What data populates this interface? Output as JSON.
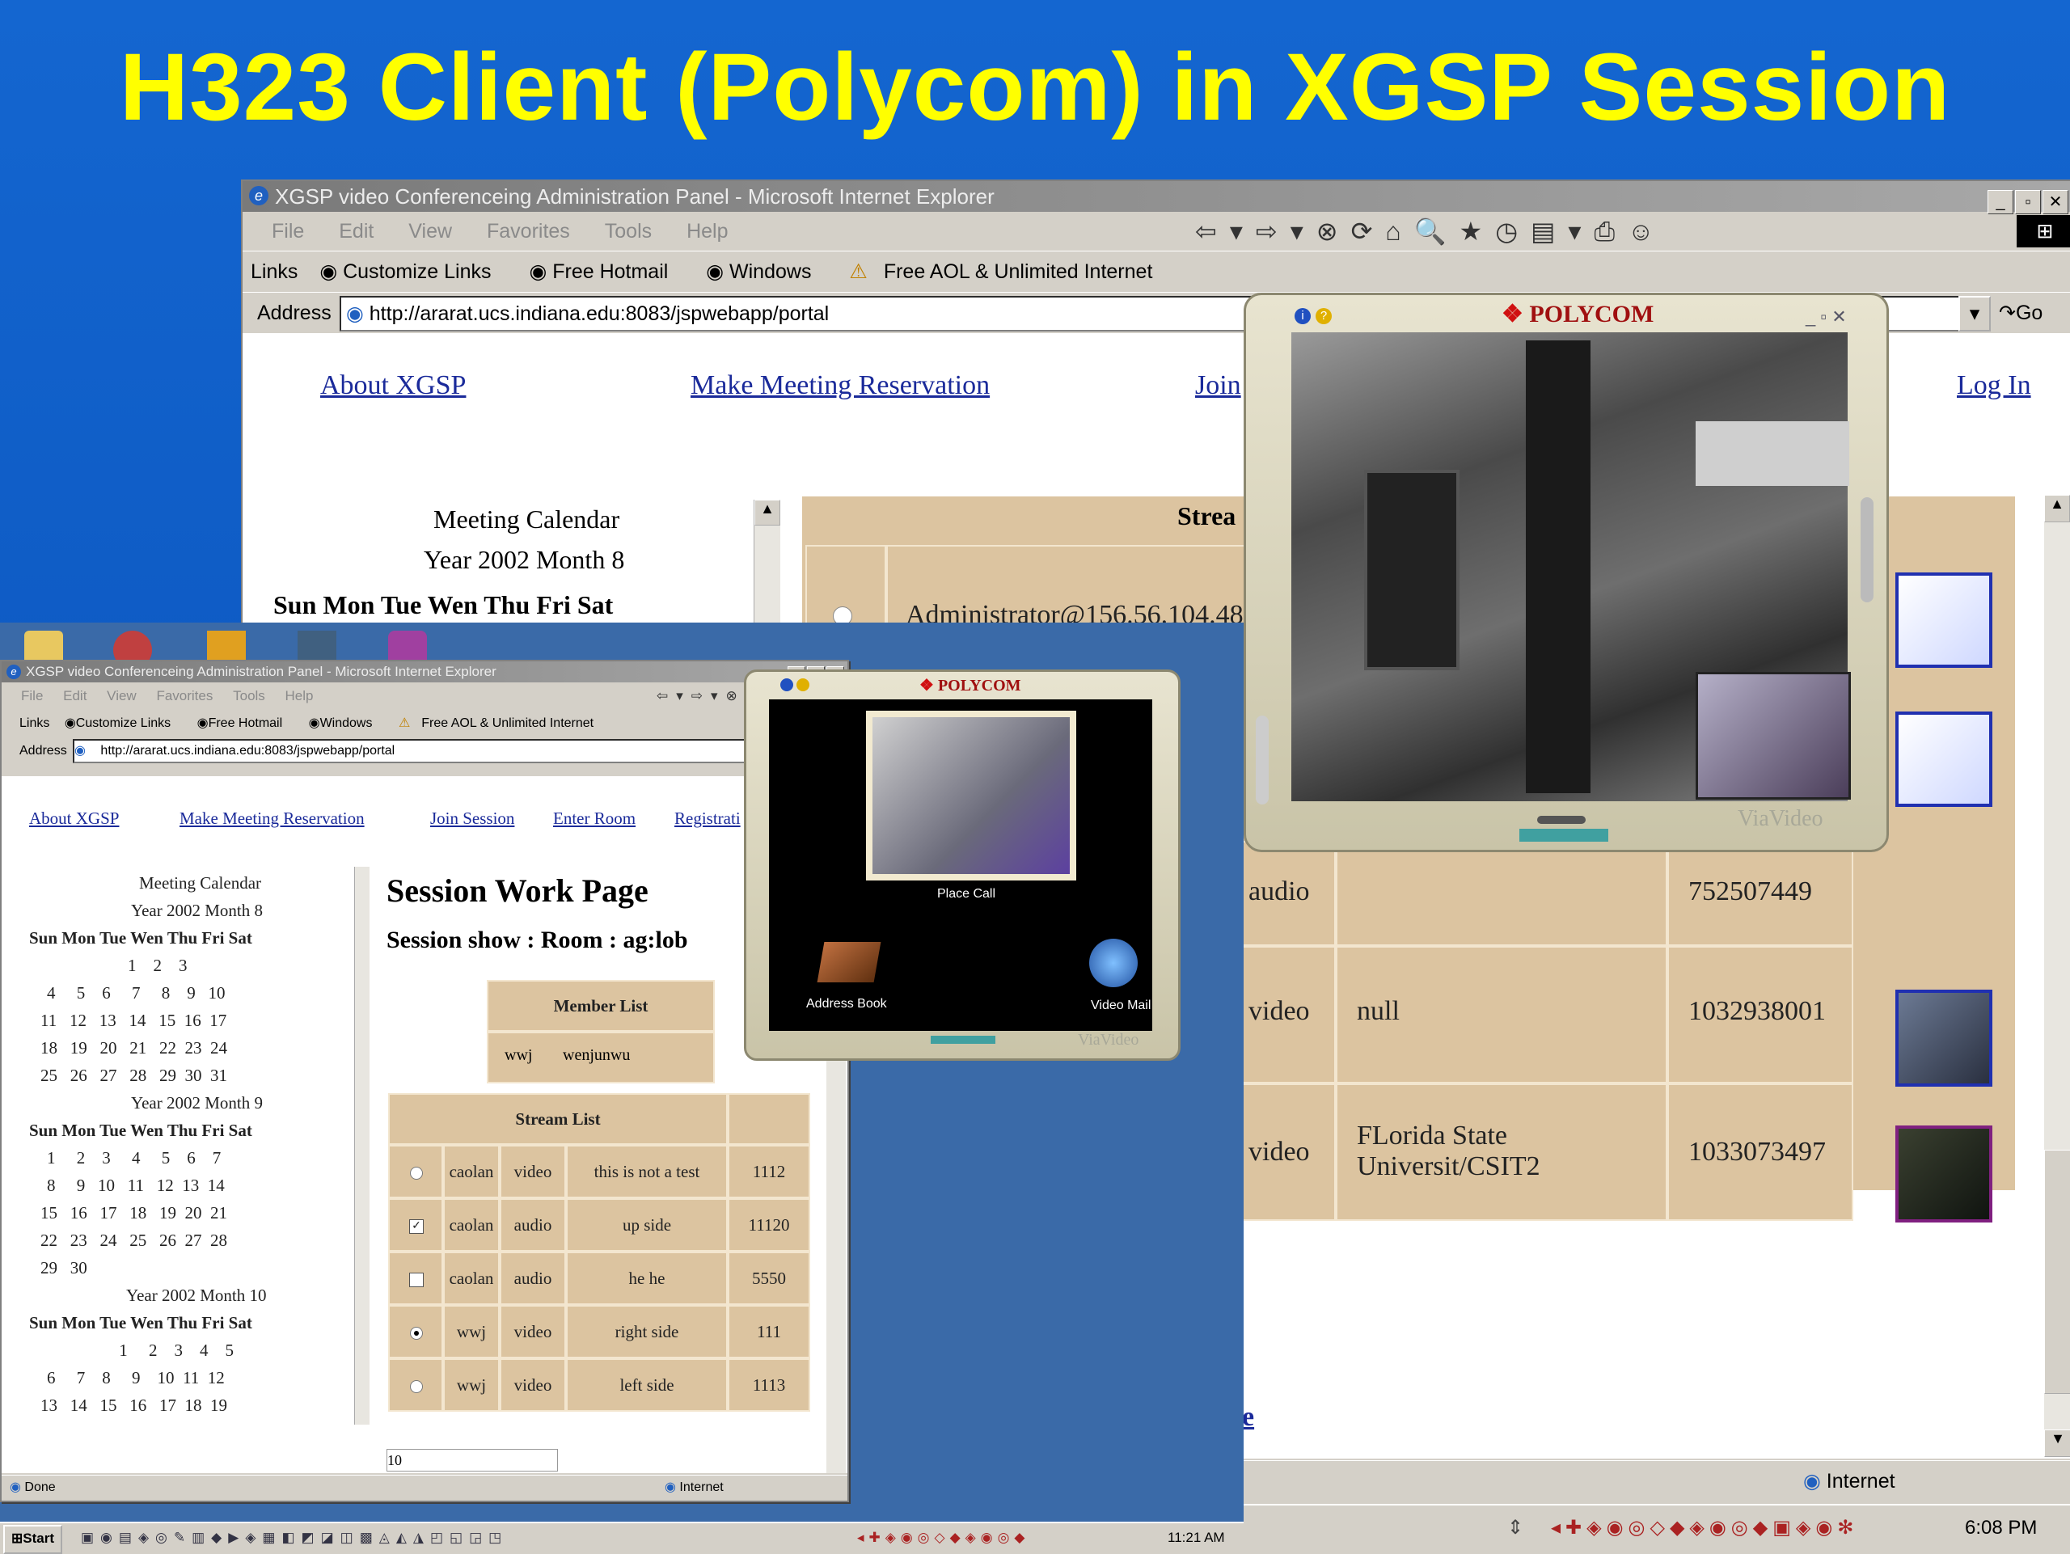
{
  "slide_title": "H323 Client (Polycom) in XGSP Session",
  "main_window": {
    "title": "XGSP video Conferenceing Administration Panel - Microsoft Internet Explorer",
    "menu": [
      "File",
      "Edit",
      "View",
      "Favorites",
      "Tools",
      "Help"
    ],
    "links_label": "Links",
    "links": [
      "Customize Links",
      "Free Hotmail",
      "Windows",
      "Free AOL & Unlimited Internet"
    ],
    "address_label": "Address",
    "address": "http://ararat.ucs.indiana.edu:8083/jspwebapp/portal",
    "go": "Go",
    "nav": {
      "about": "About XGSP",
      "reserve": "Make Meeting Reservation",
      "join": "Join",
      "login": "Log In"
    },
    "calendar": {
      "heading": "Meeting Calendar",
      "year_month": "Year 2002 Month 8",
      "days": "Sun Mon Tue Wen Thu Fri Sat"
    },
    "stream_header": "Strea",
    "admin_text": "Administrator@156.56.104.48",
    "rows": [
      {
        "type": "audio",
        "desc": "",
        "id": "752507449"
      },
      {
        "type": "video",
        "desc": "null",
        "id": "1032938001"
      },
      {
        "type": "video",
        "desc": "FLorida State Universit/CSIT2",
        "id": "1033073497"
      }
    ],
    "partial_link": "e",
    "status_zone": "Internet"
  },
  "polycom_large": {
    "brand": "POLYCOM",
    "footer": "ViaVideo"
  },
  "polycom_small": {
    "brand": "POLYCOM",
    "place_call": "Place Call",
    "address_book": "Address Book",
    "video_mail": "Video Mail",
    "footer": "ViaVideo"
  },
  "small_window": {
    "title": "XGSP video Conferenceing Administration Panel - Microsoft Internet Explorer",
    "menu": [
      "File",
      "Edit",
      "View",
      "Favorites",
      "Tools",
      "Help"
    ],
    "links_label": "Links",
    "links": [
      "Customize Links",
      "Free Hotmail",
      "Windows",
      "Free AOL & Unlimited Internet"
    ],
    "address_label": "Address",
    "address": "http://ararat.ucs.indiana.edu:8083/jspwebapp/portal",
    "nav": [
      "About XGSP",
      "Make Meeting Reservation",
      "Join Session",
      "Enter Room",
      "Registrati"
    ],
    "calendar": {
      "heading": "Meeting Calendar",
      "months": [
        {
          "label": "Year 2002 Month 8",
          "days": "Sun Mon Tue Wen Thu Fri Sat",
          "rows": [
            "                        1    2    3",
            "4     5    6     7     8    9   10",
            "11   12   13   14   15  16  17",
            "18   19   20   21   22  23  24",
            "25   26   27   28   29  30  31"
          ]
        },
        {
          "label": "Year 2002 Month 9",
          "days": "Sun Mon Tue Wen Thu Fri Sat",
          "rows": [
            "1     2    3     4     5    6    7",
            "8     9   10   11   12  13  14",
            "15   16   17   18   19  20  21",
            "22   23   24   25   26  27  28",
            "29   30"
          ]
        },
        {
          "label": "Year 2002 Month 10",
          "days": "Sun Mon Tue Wen Thu Fri Sat",
          "rows": [
            "                 1     2    3    4    5",
            "6     7    8     9    10  11  12",
            "13   14   15   16   17  18  19"
          ]
        }
      ]
    },
    "page_title": "Session Work Page",
    "session_show": "Session show : Room : ag:lob",
    "member_list": "Member List",
    "members": [
      "wwj",
      "wenjunwu"
    ],
    "stream_list": "Stream List",
    "streams": [
      {
        "user": "caolan",
        "type": "video",
        "desc": "this is not a test",
        "id": "1112"
      },
      {
        "user": "caolan",
        "type": "audio",
        "desc": "up side",
        "id": "11120"
      },
      {
        "user": "caolan",
        "type": "audio",
        "desc": "he he",
        "id": "5550"
      },
      {
        "user": "wwj",
        "type": "video",
        "desc": "right side",
        "id": "111"
      },
      {
        "user": "wwj",
        "type": "video",
        "desc": "left side",
        "id": "1113"
      }
    ],
    "input_value": "10",
    "status_done": "Done",
    "status_zone": "Internet",
    "start": "Start",
    "time": "11:21 AM"
  },
  "taskbar": {
    "time": "6:08 PM"
  }
}
